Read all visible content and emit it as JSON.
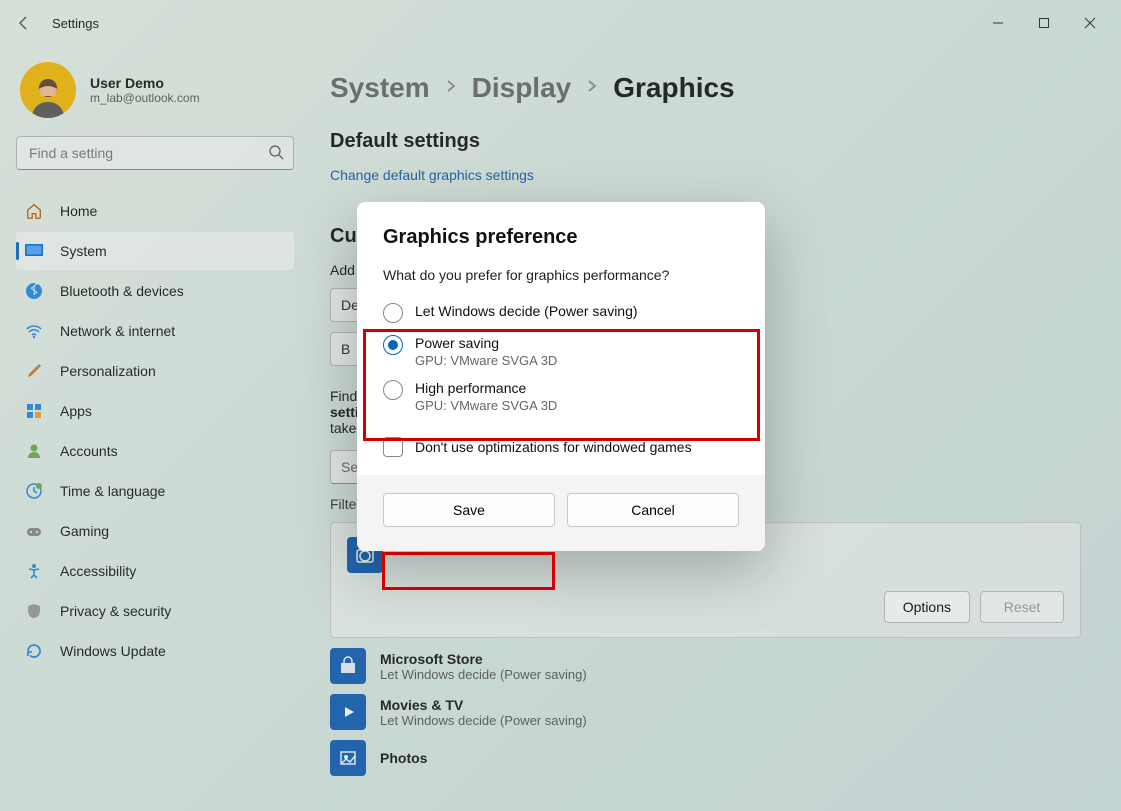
{
  "titlebar": {
    "title": "Settings"
  },
  "user": {
    "name": "User Demo",
    "email": "m_lab@outlook.com"
  },
  "search": {
    "placeholder": "Find a setting"
  },
  "nav": [
    {
      "key": "home",
      "label": "Home"
    },
    {
      "key": "system",
      "label": "System",
      "active": true
    },
    {
      "key": "bluetooth",
      "label": "Bluetooth & devices"
    },
    {
      "key": "network",
      "label": "Network & internet"
    },
    {
      "key": "personalization",
      "label": "Personalization"
    },
    {
      "key": "apps",
      "label": "Apps"
    },
    {
      "key": "accounts",
      "label": "Accounts"
    },
    {
      "key": "time",
      "label": "Time & language"
    },
    {
      "key": "gaming",
      "label": "Gaming"
    },
    {
      "key": "accessibility",
      "label": "Accessibility"
    },
    {
      "key": "privacy",
      "label": "Privacy & security"
    },
    {
      "key": "update",
      "label": "Windows Update"
    }
  ],
  "breadcrumb": {
    "a": "System",
    "b": "Display",
    "c": "Graphics"
  },
  "section_default": "Default settings",
  "link_change": "Change default graphics settings",
  "section_custom": "Custom options for apps",
  "label_add": "Add an app",
  "dropdown_prefix": "De",
  "browse_prefix": "B",
  "para_find": "Find",
  "para_setting": "setting",
  "para_take": "take",
  "search_apps_placeholder": "Sea",
  "filter_label": "Filter",
  "buttons": {
    "options": "Options",
    "reset": "Reset"
  },
  "apps": [
    {
      "name": "Microsoft Store",
      "pref": "Let Windows decide (Power saving)",
      "color": "#0b5bb1"
    },
    {
      "name": "Movies & TV",
      "pref": "Let Windows decide (Power saving)",
      "color": "#0b5bb1"
    },
    {
      "name": "Photos",
      "pref": "",
      "color": "#0b5bb1"
    }
  ],
  "dialog": {
    "title": "Graphics preference",
    "question": "What do you prefer for graphics performance?",
    "options": [
      {
        "label": "Let Windows decide (Power saving)",
        "sub": "",
        "checked": false
      },
      {
        "label": "Power saving",
        "sub": "GPU: VMware SVGA 3D",
        "checked": true
      },
      {
        "label": "High performance",
        "sub": "GPU: VMware SVGA 3D",
        "checked": false
      }
    ],
    "checkbox": "Don't use optimizations for windowed games",
    "save": "Save",
    "cancel": "Cancel"
  }
}
